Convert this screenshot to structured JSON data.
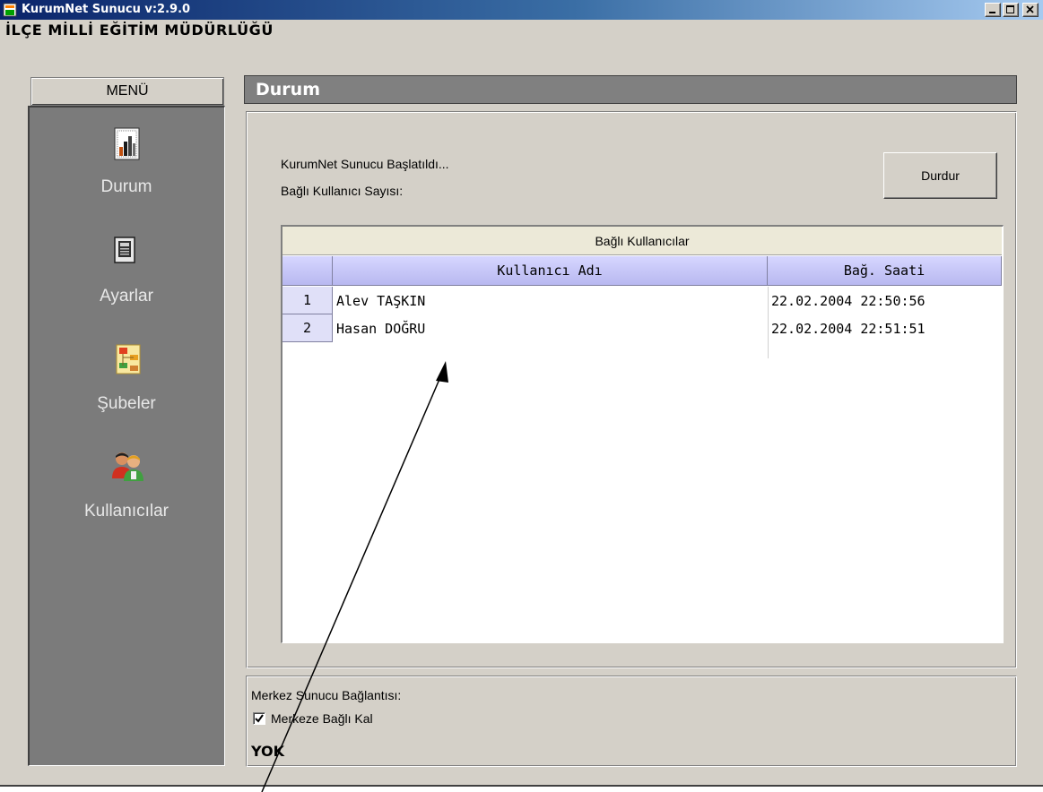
{
  "window": {
    "title": "KurumNet Sunucu v:2.9.0",
    "org_title": "İLÇE MİLLİ EĞİTİM MÜDÜRLÜĞÜ"
  },
  "sidebar": {
    "header": "MENÜ",
    "items": [
      {
        "label": "Durum",
        "icon": "report-chart-icon"
      },
      {
        "label": "Ayarlar",
        "icon": "document-icon"
      },
      {
        "label": "Şubeler",
        "icon": "branches-chart-icon"
      },
      {
        "label": "Kullanıcılar",
        "icon": "users-icon"
      }
    ]
  },
  "main": {
    "section_title": "Durum",
    "status_started": "KurumNet Sunucu Başlatıldı...",
    "connected_count_label": "Bağlı Kullanıcı Sayısı:",
    "stop_button": "Durdur",
    "table": {
      "title": "Bağlı Kullanıcılar",
      "columns": [
        "Kullanıcı Adı",
        "Bağ. Saati"
      ],
      "rows": [
        {
          "num": "1",
          "name": "Alev TAŞKIN",
          "time": "22.02.2004 22:50:56"
        },
        {
          "num": "2",
          "name": "Hasan DOĞRU",
          "time": "22.02.2004 22:51:51"
        }
      ]
    }
  },
  "bottom": {
    "connection_label": "Merkez Sunucu Bağlantısı:",
    "checkbox_label": "Merkeze Bağlı Kal",
    "checkbox_checked": true,
    "status_value": "YOK"
  }
}
